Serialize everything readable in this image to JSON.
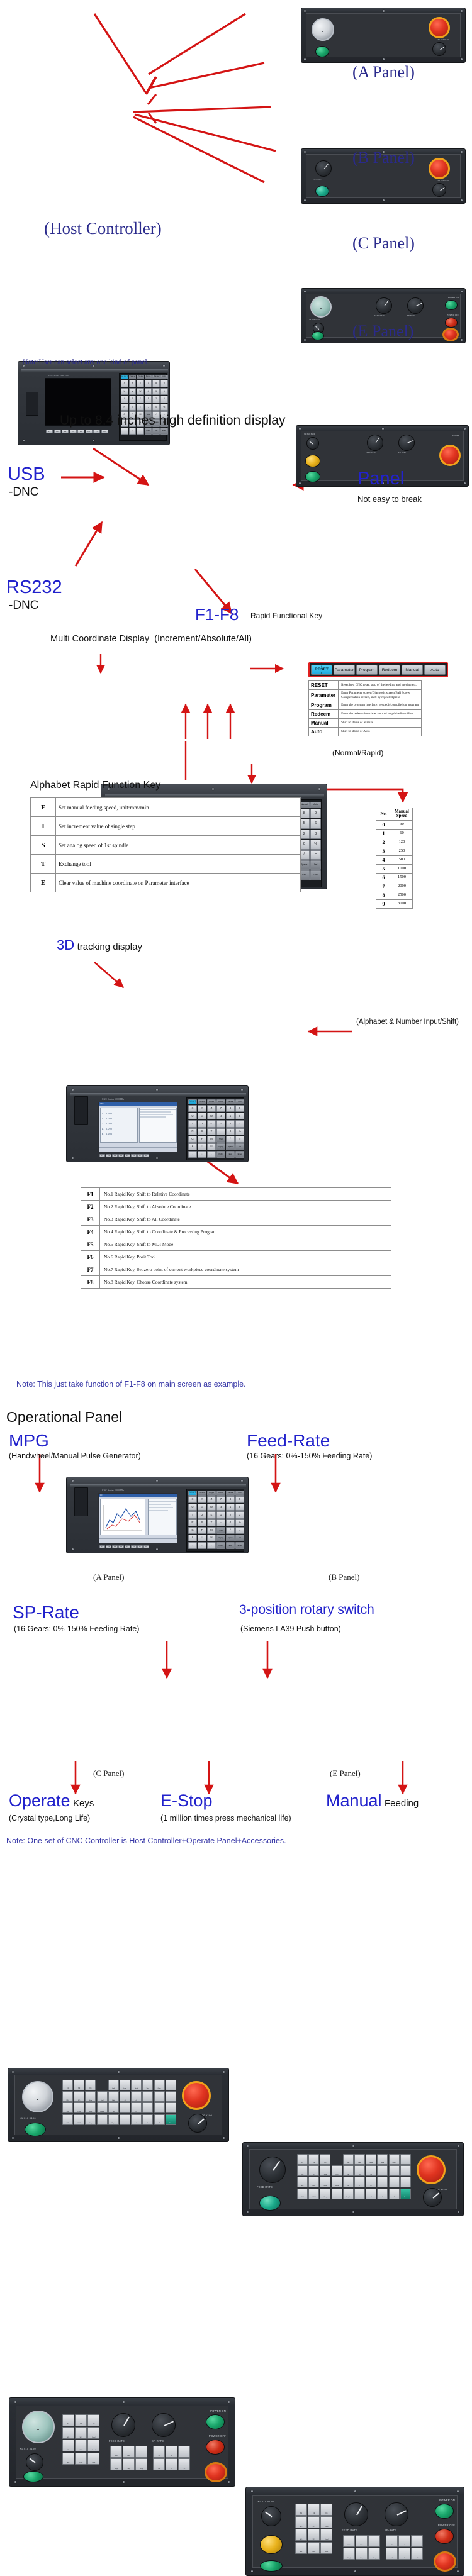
{
  "meta": {
    "device_brand_text": "CNC Series 1000TDb"
  },
  "section_panels": {
    "host_label": "(Host Controller)",
    "panel_a_label": "(A Panel)",
    "panel_b_label": "(B Panel)",
    "panel_c_label": "(C Panel)",
    "panel_e_label": "(E Panel)",
    "note": "Note:User can select any one kind of panel."
  },
  "section_display": {
    "headline": "Up to 8.4 inches high definition display",
    "usb_title": "USB",
    "usb_sub": "-DNC",
    "rs232_title": "RS232",
    "rs232_sub": "-DNC",
    "panel_title": "Panel",
    "panel_sub": "Not easy to break",
    "f_keys_title": "F1-F8",
    "f_keys_sub": "Rapid Functional Key"
  },
  "section_coordinate": {
    "title": "Multi Coordinate Display_(Increment/Absolute/All)",
    "mode_caption": "(Normal/Rapid)",
    "mode_buttons": [
      {
        "label": "RESET",
        "slash_top": "//",
        "slash_bottom": "//",
        "selected": true
      },
      {
        "label": "Parameter",
        "selected": false
      },
      {
        "label": "Program",
        "selected": false
      },
      {
        "label": "Redeem",
        "selected": false
      },
      {
        "label": "Manual",
        "selected": false
      },
      {
        "label": "Auto",
        "selected": false
      }
    ],
    "mode_table": [
      {
        "key": "RESET",
        "desc": "Reset key, CNC reset, stop of the feeding and moving,etc."
      },
      {
        "key": "Parameter",
        "desc": "Enter Parameter screen/Diagnosis screen/Ball Screw Compensation screen, shift by repeated press"
      },
      {
        "key": "Program",
        "desc": "Enter the program interface, new/edit/compile/run program"
      },
      {
        "key": "Redeem",
        "desc": "Enter the redeem interface, set tool length/radius offset"
      },
      {
        "key": "Manual",
        "desc": "Shift to status of Manual"
      },
      {
        "key": "Auto",
        "desc": "Shift to status of Auto"
      }
    ],
    "screen_axes": [
      "X",
      "Y",
      "Z",
      "A",
      "B"
    ],
    "screen_values": [
      "0.000",
      "0.000",
      "0.000",
      "0.000",
      "0.000"
    ]
  },
  "section_alphabet": {
    "title": "Alphabet Rapid Function Key",
    "rows": [
      {
        "key": "F",
        "desc": "Set manual feeding speed, unit:mm/min"
      },
      {
        "key": "I",
        "desc": "Set increment value of single step"
      },
      {
        "key": "S",
        "desc": "Set analog speed of 1st spindle"
      },
      {
        "key": "T",
        "desc": "Exchange tool"
      },
      {
        "key": "E",
        "desc": "Clear value of machine coordinate on Parameter interface"
      }
    ],
    "speed_table": {
      "headers": [
        "No.",
        "Manual Speed"
      ],
      "rows": [
        {
          "no": "0",
          "speed": "30"
        },
        {
          "no": "1",
          "speed": "60"
        },
        {
          "no": "2",
          "speed": "120"
        },
        {
          "no": "3",
          "speed": "250"
        },
        {
          "no": "4",
          "speed": "500"
        },
        {
          "no": "5",
          "speed": "1000"
        },
        {
          "no": "6",
          "speed": "1500"
        },
        {
          "no": "7",
          "speed": "2000"
        },
        {
          "no": "8",
          "speed": "2500"
        },
        {
          "no": "9",
          "speed": "3000"
        }
      ]
    }
  },
  "section_3d": {
    "title": "3D",
    "subtitle": "tracking display",
    "input_label": "(Alphabet & Number Input/Shift)",
    "fn_table": [
      {
        "key": "F1",
        "desc": "No.1 Rapid Key, Shift to Relative Coordinate"
      },
      {
        "key": "F2",
        "desc": "No.2 Rapid Key, Shift to Absolute Coordinate"
      },
      {
        "key": "F3",
        "desc": "No.3 Rapid Key, Shift to All Coordinate"
      },
      {
        "key": "F4",
        "desc": "No.4 Rapid Key, Shift to Coordinate & Processing Program"
      },
      {
        "key": "F5",
        "desc": "No.5 Rapid Key, Shift to MDI Mode"
      },
      {
        "key": "F6",
        "desc": "No.6 Rapid Key, Posit Tool"
      },
      {
        "key": "F7",
        "desc": "No.7 Rapid Key, Set zero point of current workpiece coordinate system"
      },
      {
        "key": "F8",
        "desc": "No.8 Rapid Key, Choose Coordinate system"
      }
    ],
    "note": "Note: This just take function of F1-F8 on main screen as example."
  },
  "section_operational": {
    "title": "Operational Panel",
    "mpg_title": "MPG",
    "mpg_sub": "(Handwheel/Manual Pulse Generator)",
    "feed_title": "Feed-Rate",
    "feed_sub": "(16 Gears: 0%-150% Feeding Rate)",
    "sp_title": "SP-Rate",
    "sp_sub": "(16 Gears: 0%-150% Feeding Rate)",
    "rotary_title": "3-position rotary switch",
    "rotary_sub": "(Siemens LA39 Push button)",
    "operate_title": "Operate",
    "operate_title_small": "Keys",
    "operate_sub": "(Crystal type,Long Life)",
    "estop_title": "E-Stop",
    "estop_sub": "(1 million times press mechanical life)",
    "manual_title": "Manual",
    "manual_title_small": "Feeding",
    "panel_a_label": "(A Panel)",
    "panel_b_label": "(B Panel)",
    "panel_c_label": "(C Panel)",
    "panel_e_label": "(E Panel)",
    "final_note": "Note: One set of CNC Controller is Host Controller+Operate Panel+Accessories."
  },
  "keypad": {
    "mode_row": [
      "RESET",
      "Parameter",
      "Program",
      "Redeem",
      "Manual",
      "Auto"
    ],
    "rows": [
      [
        "X",
        "Y",
        "Z",
        "7",
        "8",
        "9"
      ],
      [
        "U",
        "V",
        "W",
        "4",
        "5",
        "6"
      ],
      [
        "I",
        "J",
        "K",
        "1",
        "2",
        "3"
      ],
      [
        "R",
        "S",
        "T",
        "-",
        "0",
        "%"
      ],
      [
        "G",
        "F",
        "M",
        "Shift",
        "/",
        "="
      ],
      [
        "L",
        "↑",
        "H",
        "PgUp",
        "Space",
        "Del"
      ],
      [
        "←",
        "↓",
        "→",
        "PgDn",
        "Esc",
        "Enter"
      ]
    ],
    "fbar": [
      "F1",
      "F2",
      "F3",
      "F4",
      "F5",
      "F6",
      "F7",
      "F8"
    ]
  },
  "op_panel_keys": {
    "k_row": [
      "K1",
      "K2",
      "K3"
    ],
    "feed_label": "FEED RATE",
    "sp_label": "SP-RATE",
    "power_on": "POWER ON",
    "power_off": "POWER OFF",
    "mpg_scale": "X1 X10 X100"
  },
  "colors": {
    "accent_blue": "#2222cc",
    "serif_blue": "#2a2a8c",
    "arrow_red": "#d41414",
    "selected_cyan": "#1ba8dd"
  }
}
